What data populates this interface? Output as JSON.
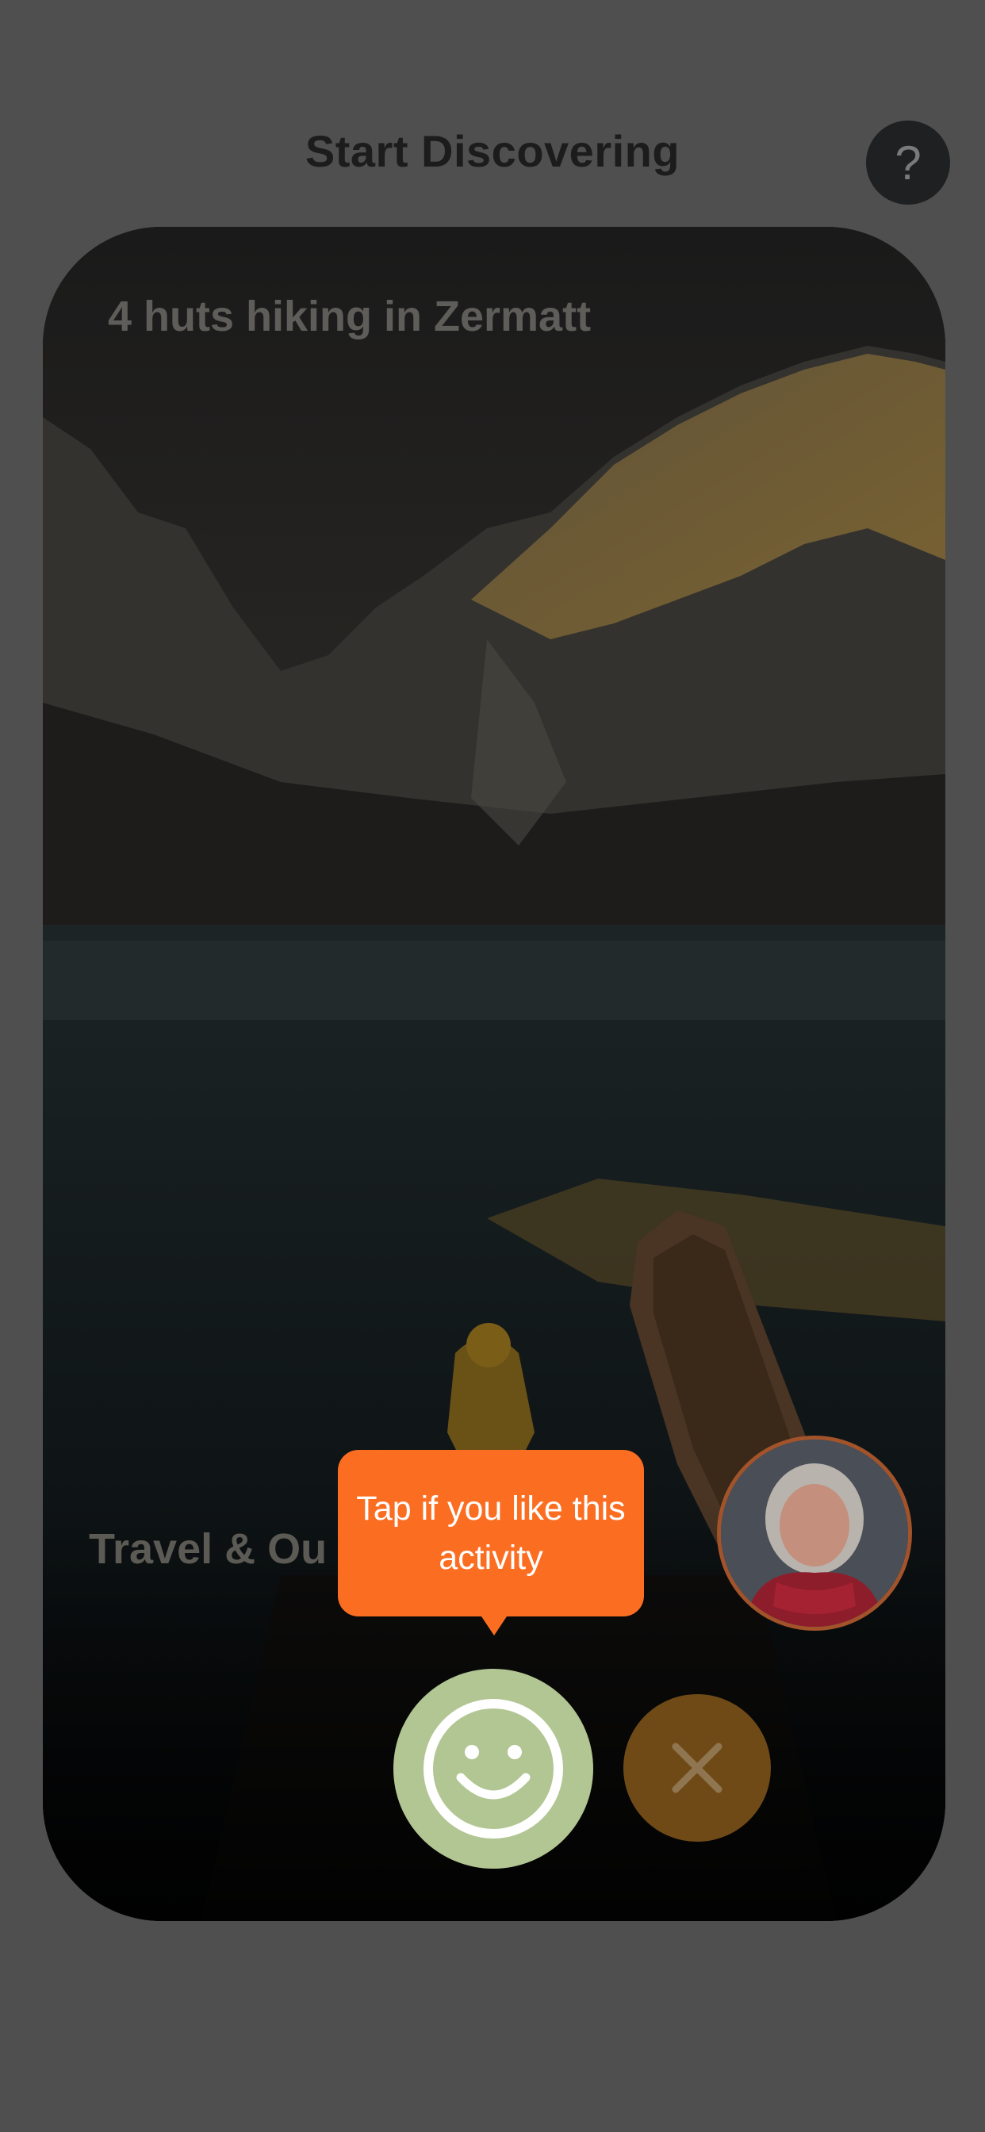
{
  "header": {
    "title": "Start Discovering",
    "help_label": "?"
  },
  "card": {
    "title": "4 huts hiking in Zermatt",
    "category": "Travel & Ou",
    "image": "mountain lake with boat and child in yellow raincoat"
  },
  "tooltip": {
    "text": "Tap if you like this activity"
  },
  "actions": {
    "like_icon": "smiley-icon",
    "dismiss_icon": "close-icon"
  },
  "colors": {
    "background": "#4f4f4f",
    "tooltip": "#fb6e22",
    "like": "#b2c693",
    "dismiss": "#6f4a17"
  }
}
